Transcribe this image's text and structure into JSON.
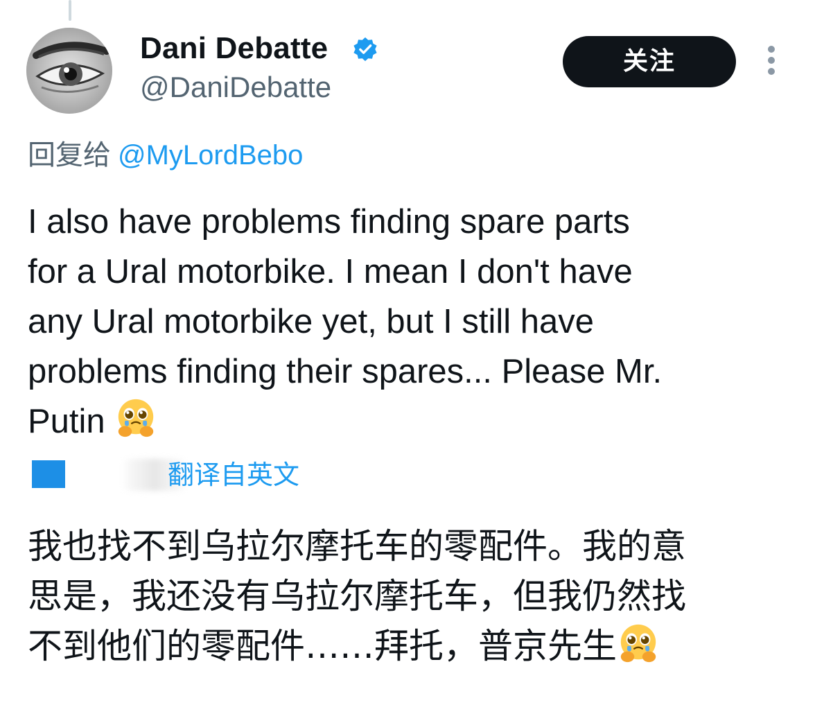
{
  "author": {
    "name": "Dani Debatte",
    "handle": "@DaniDebatte",
    "verified_icon": "verified-badge-icon",
    "avatar_icon": "eye-avatar"
  },
  "follow_label": "关注",
  "more_icon": "more-vertical-icon",
  "reply": {
    "label": "回复给",
    "target": "@MyLordBebo"
  },
  "tweet": {
    "lines": [
      "I also have problems finding spare parts",
      "for a Ural motorbike. I mean I don't have",
      "any Ural motorbike yet, but I still have",
      "problems finding their spares... Please Mr.",
      "Putin"
    ],
    "emoji": "pleading-face-hands-emoji"
  },
  "translation": {
    "label": "翻译自英文",
    "lines": [
      "我也找不到乌拉尔摩托车的零配件。我的意",
      "思是，我还没有乌拉尔摩托车，但我仍然找",
      "不到他们的零配件……拜托，普京先生"
    ]
  },
  "colors": {
    "accent": "#1d9bf0",
    "secondary_text": "#536471",
    "text": "#0f1419",
    "button_bg": "#0f1419"
  }
}
